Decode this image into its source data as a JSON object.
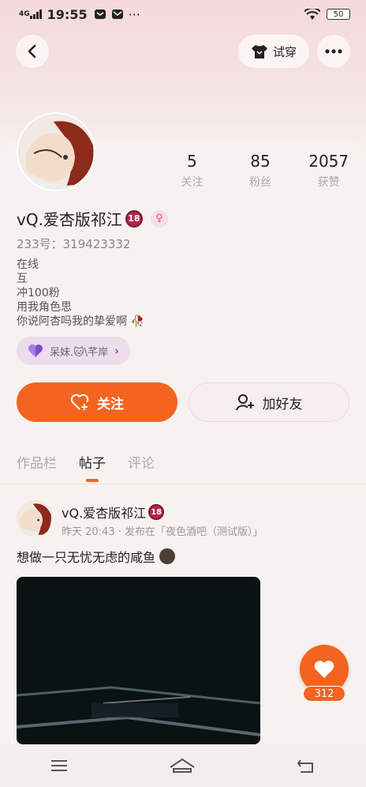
{
  "status_bar": {
    "network": "4G",
    "time": "19:55",
    "battery": "50"
  },
  "header": {
    "try_on_label": "试穿"
  },
  "profile": {
    "username": "vQ.爱杏版祁江",
    "level_badge": "18",
    "gender_icon": "female-icon",
    "uid_label": "233号：",
    "uid_value": "319423332",
    "bio_lines": [
      "在线",
      "互",
      "冲100粉",
      "用我角色思",
      "你说阿杏吗我的挚爱啊"
    ],
    "cp_label": "呆妹.🐱\\芊岸",
    "stats": [
      {
        "num": "5",
        "label": "关注"
      },
      {
        "num": "85",
        "label": "粉丝"
      },
      {
        "num": "2057",
        "label": "获赞"
      }
    ]
  },
  "actions": {
    "follow": "关注",
    "add_friend": "加好友"
  },
  "tabs": [
    "作品栏",
    "帖子",
    "评论"
  ],
  "active_tab": 1,
  "post": {
    "author": "vQ.爱杏版祁江",
    "meta": "昨天 20:43 · 发布在「夜色酒吧（测试版）」",
    "text": "想做一只无忧无虑的咸鱼"
  },
  "like": {
    "count": "312"
  },
  "colors": {
    "accent": "#f4641e",
    "badge": "#b3264a"
  }
}
